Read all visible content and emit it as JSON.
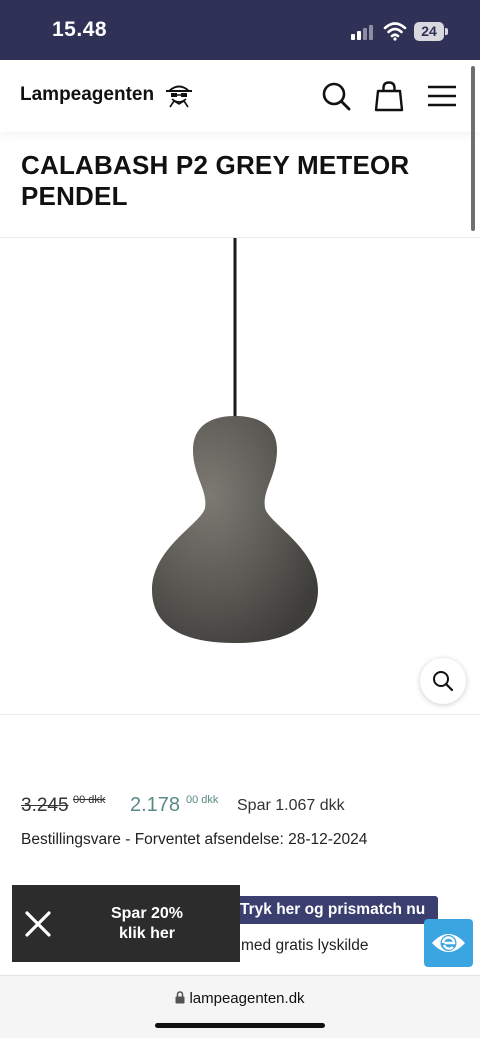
{
  "status_bar": {
    "time": "15.48",
    "battery": "24"
  },
  "header": {
    "logo_text": "Lampeagenten",
    "icons": [
      "search-icon",
      "bag-icon",
      "menu-icon"
    ]
  },
  "product": {
    "title": "CALABASH P2 GREY METEOR PENDEL",
    "old_price": "3.245",
    "old_price_decimals": "00 dkk",
    "new_price": "2.178",
    "new_price_decimals": "00 dkk",
    "savings": "Spar 1.067 dkk",
    "availability": "Bestillingsvare - Forventet afsendelse: 28-12-2024"
  },
  "promo": {
    "discount_label_line1": "Spar 20%",
    "discount_label_line2": "klik her",
    "pricematch_label": "Tryk her og prismatch nu",
    "gratis_text": "med gratis lyskilde"
  },
  "browser": {
    "url": "lampeagenten.dk"
  },
  "colors": {
    "status_bar_bg": "#2f3156",
    "sale_price": "#5b8a86",
    "pricematch_bg": "#3b3f70",
    "eye_button_bg": "#3aa5e0",
    "promo_bg": "#2c2c2c"
  }
}
